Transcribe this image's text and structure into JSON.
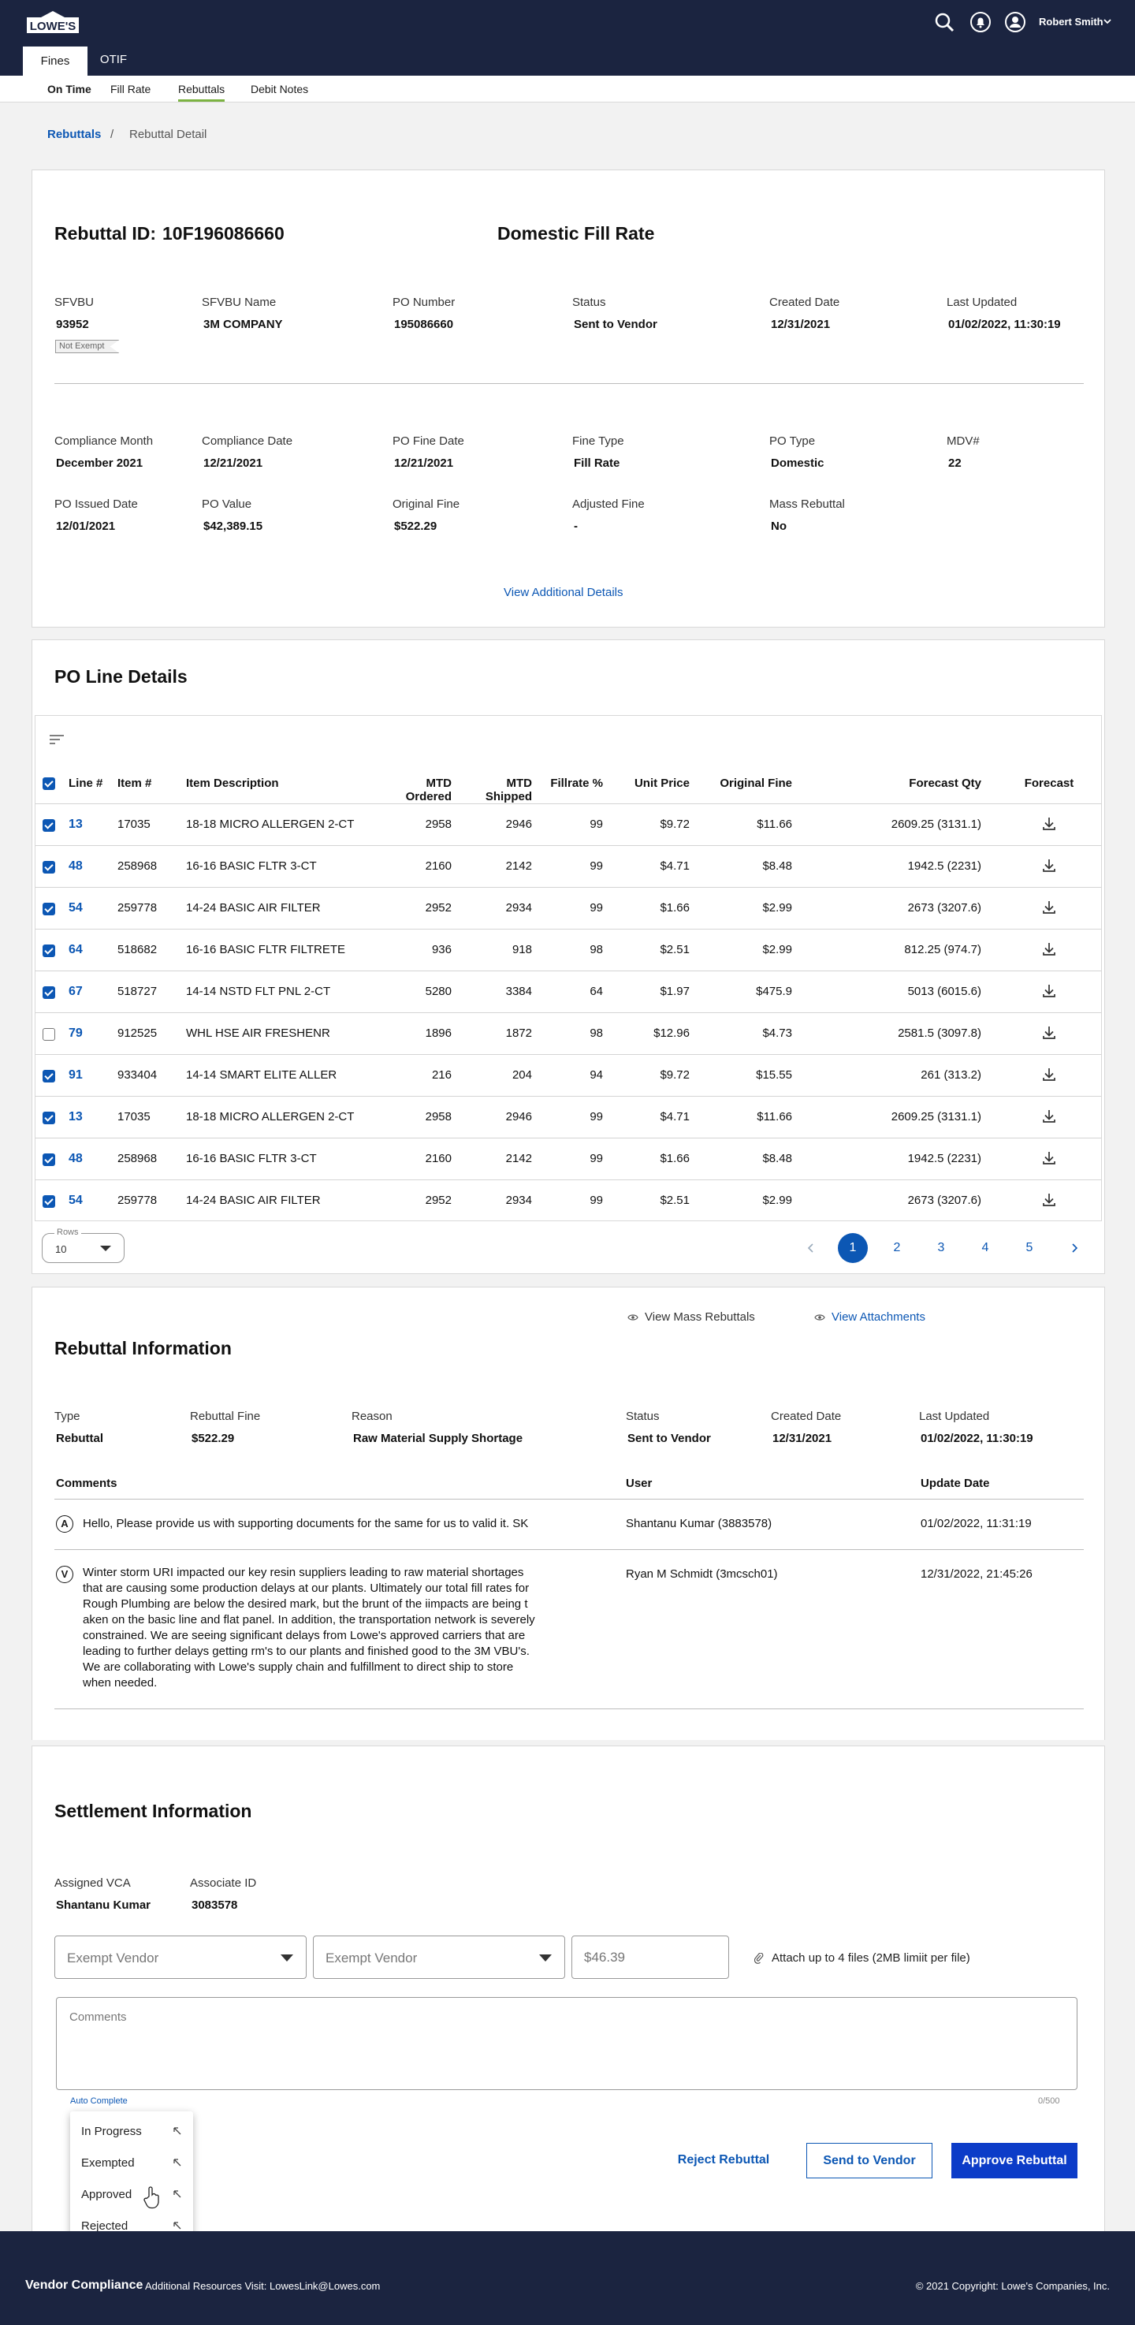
{
  "header": {
    "user_name": "Robert Smith",
    "logo_text": "LOWE'S"
  },
  "tabs": [
    "Fines",
    "OTIF"
  ],
  "subnav": [
    "On Time",
    "Fill Rate",
    "Rebuttals",
    "Debit Notes"
  ],
  "breadcrumb": {
    "parent": "Rebuttals",
    "separator": "/",
    "current": "Rebuttal Detail"
  },
  "summary": {
    "rebuttal_id_label": "Rebuttal ID:",
    "rebuttal_id": "10F196086660",
    "fine_title": "Domestic Fill Rate",
    "exempt_badge": "Not Exempt",
    "fields_top": [
      {
        "label": "SFVBU",
        "value": "93952"
      },
      {
        "label": "SFVBU Name",
        "value": "3M COMPANY"
      },
      {
        "label": "PO Number",
        "value": "195086660"
      },
      {
        "label": "Status",
        "value": "Sent to Vendor"
      },
      {
        "label": "Created Date",
        "value": "12/31/2021"
      },
      {
        "label": "Last Updated",
        "value": "01/02/2022, 11:30:19"
      }
    ],
    "fields_mid": [
      {
        "label": "Compliance Month",
        "value": "December 2021"
      },
      {
        "label": "Compliance Date",
        "value": "12/21/2021"
      },
      {
        "label": "PO Fine Date",
        "value": "12/21/2021"
      },
      {
        "label": "Fine Type",
        "value": "Fill Rate"
      },
      {
        "label": "PO Type",
        "value": "Domestic"
      },
      {
        "label": "MDV#",
        "value": "22"
      }
    ],
    "fields_bot": [
      {
        "label": "PO Issued Date",
        "value": "12/01/2021"
      },
      {
        "label": "PO Value",
        "value": "$42,389.15"
      },
      {
        "label": "Original Fine",
        "value": "$522.29"
      },
      {
        "label": "Adjusted Fine",
        "value": "-"
      },
      {
        "label": "Mass Rebuttal",
        "value": "No"
      }
    ],
    "view_more": "View Additional Details"
  },
  "po_lines": {
    "title": "PO Line Details",
    "columns": [
      "Line #",
      "Item #",
      "Item Description",
      "MTD Ordered",
      "MTD Shipped",
      "Fillrate %",
      "Unit Price",
      "Original Fine",
      "Forecast Qty",
      "Forecast"
    ],
    "rows": [
      {
        "checked": true,
        "line": "13",
        "item": "17035",
        "desc": "18-18 MICRO ALLERGEN 2-CT",
        "ordered": "2958",
        "shipped": "2946",
        "fillrate": "99",
        "price": "$9.72",
        "fine": "$11.66",
        "forecast": "2609.25 (3131.1)"
      },
      {
        "checked": true,
        "line": "48",
        "item": "258968",
        "desc": "16-16 BASIC FLTR 3-CT",
        "ordered": "2160",
        "shipped": "2142",
        "fillrate": "99",
        "price": "$4.71",
        "fine": "$8.48",
        "forecast": "1942.5 (2231)"
      },
      {
        "checked": true,
        "line": "54",
        "item": "259778",
        "desc": "14-24 BASIC AIR FILTER",
        "ordered": "2952",
        "shipped": "2934",
        "fillrate": "99",
        "price": "$1.66",
        "fine": "$2.99",
        "forecast": "2673 (3207.6)"
      },
      {
        "checked": true,
        "line": "64",
        "item": "518682",
        "desc": "16-16 BASIC FLTR FILTRETE",
        "ordered": "936",
        "shipped": "918",
        "fillrate": "98",
        "price": "$2.51",
        "fine": "$2.99",
        "forecast": "812.25 (974.7)"
      },
      {
        "checked": true,
        "line": "67",
        "item": "518727",
        "desc": "14-14 NSTD FLT PNL 2-CT",
        "ordered": "5280",
        "shipped": "3384",
        "fillrate": "64",
        "price": "$1.97",
        "fine": "$475.9",
        "forecast": "5013 (6015.6)"
      },
      {
        "checked": false,
        "line": "79",
        "item": "912525",
        "desc": "WHL HSE AIR FRESHENR",
        "ordered": "1896",
        "shipped": "1872",
        "fillrate": "98",
        "price": "$12.96",
        "fine": "$4.73",
        "forecast": "2581.5 (3097.8)"
      },
      {
        "checked": true,
        "line": "91",
        "item": "933404",
        "desc": "14-14 SMART ELITE ALLER",
        "ordered": "216",
        "shipped": "204",
        "fillrate": "94",
        "price": "$9.72",
        "fine": "$15.55",
        "forecast": "261 (313.2)"
      },
      {
        "checked": true,
        "line": "13",
        "item": "17035",
        "desc": "18-18 MICRO ALLERGEN 2-CT",
        "ordered": "2958",
        "shipped": "2946",
        "fillrate": "99",
        "price": "$4.71",
        "fine": "$11.66",
        "forecast": "2609.25 (3131.1)"
      },
      {
        "checked": true,
        "line": "48",
        "item": "258968",
        "desc": "16-16 BASIC FLTR 3-CT",
        "ordered": "2160",
        "shipped": "2142",
        "fillrate": "99",
        "price": "$1.66",
        "fine": "$8.48",
        "forecast": "1942.5 (2231)"
      },
      {
        "checked": true,
        "line": "54",
        "item": "259778",
        "desc": "14-24 BASIC AIR FILTER",
        "ordered": "2952",
        "shipped": "2934",
        "fillrate": "99",
        "price": "$2.51",
        "fine": "$2.99",
        "forecast": "2673 (3207.6)"
      }
    ],
    "rows_label": "Rows",
    "rows_value": "10",
    "pages": [
      "1",
      "2",
      "3",
      "4",
      "5"
    ],
    "current_page": "1"
  },
  "rebuttal_info": {
    "title": "Rebuttal Information",
    "view_mass": "View Mass Rebuttals",
    "view_attachments": "View Attachments",
    "fields": [
      {
        "label": "Type",
        "value": "Rebuttal"
      },
      {
        "label": "Rebuttal Fine",
        "value": "$522.29"
      },
      {
        "label": "Reason",
        "value": "Raw Material Supply Shortage"
      },
      {
        "label": "Status",
        "value": "Sent to Vendor"
      },
      {
        "label": "Created Date",
        "value": "12/31/2021"
      },
      {
        "label": "Last Updated",
        "value": "01/02/2022, 11:30:19"
      }
    ],
    "comment_headers": [
      "Comments",
      "User",
      "Update Date"
    ],
    "comments": [
      {
        "initial": "A",
        "lines": [
          "Hello, Please provide us with supporting documents for the same for us to valid it.  SK"
        ],
        "user": "Shantanu Kumar (3883578)",
        "date": "01/02/2022, 11:31:19"
      },
      {
        "initial": "V",
        "lines": [
          "Winter storm URI impacted our key resin suppliers leading to raw material shortages",
          "that are causing some production delays at our plants.  Ultimately our total fill rates for",
          "Rough Plumbing are below the desired mark, but the brunt of the iimpacts are being t",
          "aken on the basic line and flat panel.  In addition, the transportation network is severely",
          "constrained.  We are seeing significant delays from Lowe's approved carriers that are",
          "leading to further delays getting rm's to our plants and finished good to the 3M VBU's.",
          "We are collaborating with Lowe's supply chain and fulfillment to direct ship to store",
          "when needed."
        ],
        "user": "Ryan M Schmidt (3mcsch01)",
        "date": "12/31/2022, 21:45:26"
      }
    ]
  },
  "settlement": {
    "title": "Settlement Information",
    "fields": [
      {
        "label": "Assigned VCA",
        "value": "Shantanu Kumar"
      },
      {
        "label": "Associate ID",
        "value": "3083578"
      }
    ],
    "dropdown1": "Exempt Vendor",
    "dropdown2": "Exempt Vendor",
    "amount_placeholder": "$46.39",
    "attach_text": "Attach up to 4 files (2MB limiit per file)",
    "comments_placeholder": "Comments",
    "counter": "0/500",
    "auto_complete": "Auto Complete",
    "menu": [
      "In Progress",
      "Exempted",
      "Approved",
      "Rejected"
    ],
    "buttons": {
      "reject": "Reject Rebuttal",
      "send": "Send to Vendor",
      "approve": "Approve Rebuttal"
    }
  },
  "footer": {
    "brand": "Vendor Compliance",
    "resources": "Additional Resources Visit: LowesLink@Lowes.com",
    "copyright": "© 2021 Copyright: Lowe's Companies, Inc."
  },
  "colors": {
    "nav": "#1b2440",
    "link": "#0c57b4",
    "primary": "#0c3cc8",
    "accent": "#7cb342"
  }
}
